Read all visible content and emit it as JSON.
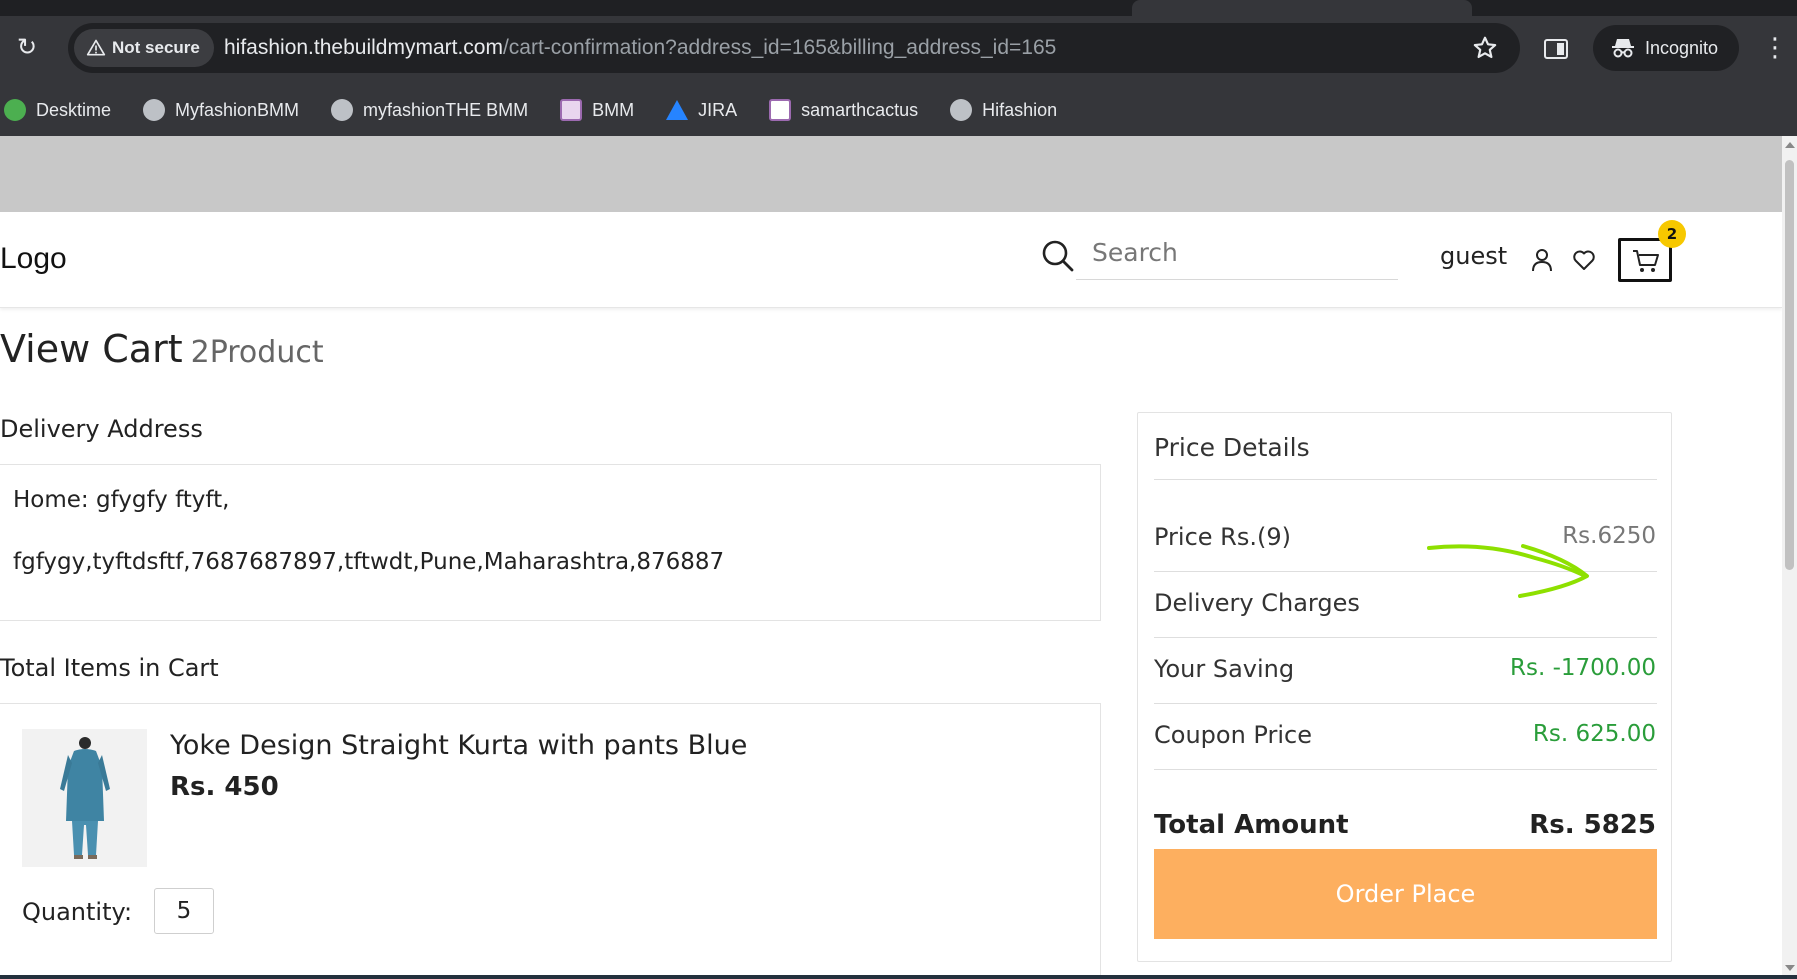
{
  "browser": {
    "security_label": "Not secure",
    "url_host": "hifashion.thebuildmymart.com",
    "url_path": "/cart-confirmation?address_id=165&billing_address_id=165",
    "incognito_label": "Incognito",
    "bookmarks": [
      {
        "label": "Desktime",
        "icon": "desktime-icon",
        "color": "#4caf50"
      },
      {
        "label": "MyfashionBMM",
        "icon": "globe-icon",
        "color": "#bdc1c6"
      },
      {
        "label": "myfashionTHE BMM",
        "icon": "globe-icon",
        "color": "#bdc1c6"
      },
      {
        "label": "BMM",
        "icon": "bmm-icon",
        "color": "#e9d6ef"
      },
      {
        "label": "JIRA",
        "icon": "jira-icon",
        "color": "#2684ff"
      },
      {
        "label": "samarthcactus",
        "icon": "cactus-icon",
        "color": "#ffffff"
      },
      {
        "label": "Hifashion",
        "icon": "globe-icon",
        "color": "#bdc1c6"
      }
    ]
  },
  "header": {
    "logo": "Logo",
    "search_placeholder": "Search",
    "user_label": "guest",
    "cart_count": "2"
  },
  "cart": {
    "title": "View Cart",
    "product_count": "2Product",
    "delivery_address_title": "Delivery Address",
    "address_line1": "Home: gfygfy ftyft,",
    "address_line2": "fgfygy,tyftdsftf,7687687897,tftwdt,Pune,Maharashtra,876887",
    "items_title": "Total Items in Cart",
    "items": [
      {
        "name": "Yoke Design Straight Kurta with pants Blue",
        "price": "Rs. 450",
        "quantity_label": "Quantity:",
        "quantity": "5"
      }
    ]
  },
  "price_details": {
    "title": "Price Details",
    "rows": [
      {
        "label": "Price Rs.(9)",
        "value": "Rs.6250"
      },
      {
        "label": "Delivery Charges",
        "value": ""
      },
      {
        "label": "Your Saving",
        "value": "Rs. -1700.00"
      },
      {
        "label": "Coupon Price",
        "value": "Rs. 625.00"
      }
    ],
    "total_label": "Total Amount",
    "total_value": "Rs. 5825",
    "order_button": "Order Place"
  },
  "colors": {
    "accent_orange": "#fdaf5f",
    "green": "#2a9d3a",
    "badge": "#f7c800",
    "annotation_arrow": "#8ee000"
  }
}
